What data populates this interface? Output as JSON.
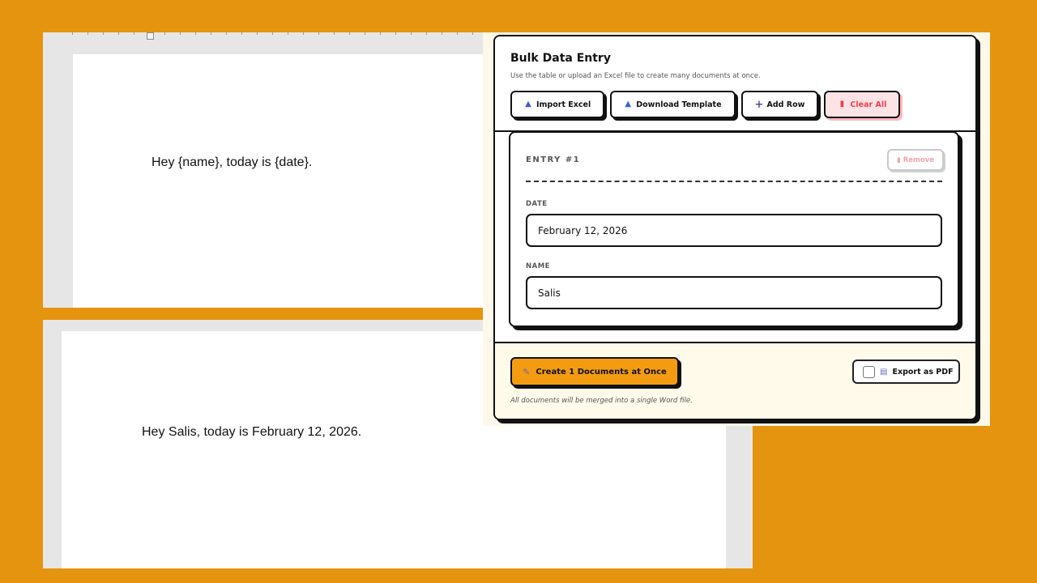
{
  "template_doc": {
    "text": "Hey {name}, today is {date}."
  },
  "output_doc": {
    "text": "Hey Salis, today is February 12, 2026."
  },
  "bulk_entry": {
    "title": "Bulk Data Entry",
    "subtitle": "Use the table or upload an Excel file to create many documents at once.",
    "toolbar": {
      "import_label": "Import Excel",
      "download_label": "Download Template",
      "add_row_label": "Add Row",
      "clear_all_label": "Clear All"
    },
    "entries": [
      {
        "label": "ENTRY #1",
        "remove_label": "Remove",
        "fields": {
          "date_label": "DATE",
          "date_value": "February 12, 2026",
          "name_label": "NAME",
          "name_value": "Salis"
        }
      }
    ],
    "footer": {
      "create_label": "Create 1 Documents at Once",
      "export_label": "Export as PDF",
      "export_checked": false,
      "note": "All documents will be merged into a single Word file."
    },
    "icons": {
      "import": "upload-icon",
      "download": "download-icon",
      "add_row": "plus-icon",
      "clear_all": "trash-icon",
      "remove": "trash-icon",
      "create": "pencil-icon",
      "export": "document-icon"
    },
    "colors": {
      "background": "#e5940f",
      "primary_button": "#f39c12",
      "danger_bg": "#fde3e5",
      "danger_text": "#ef3e4d",
      "footer_bg": "#fffaea"
    }
  }
}
